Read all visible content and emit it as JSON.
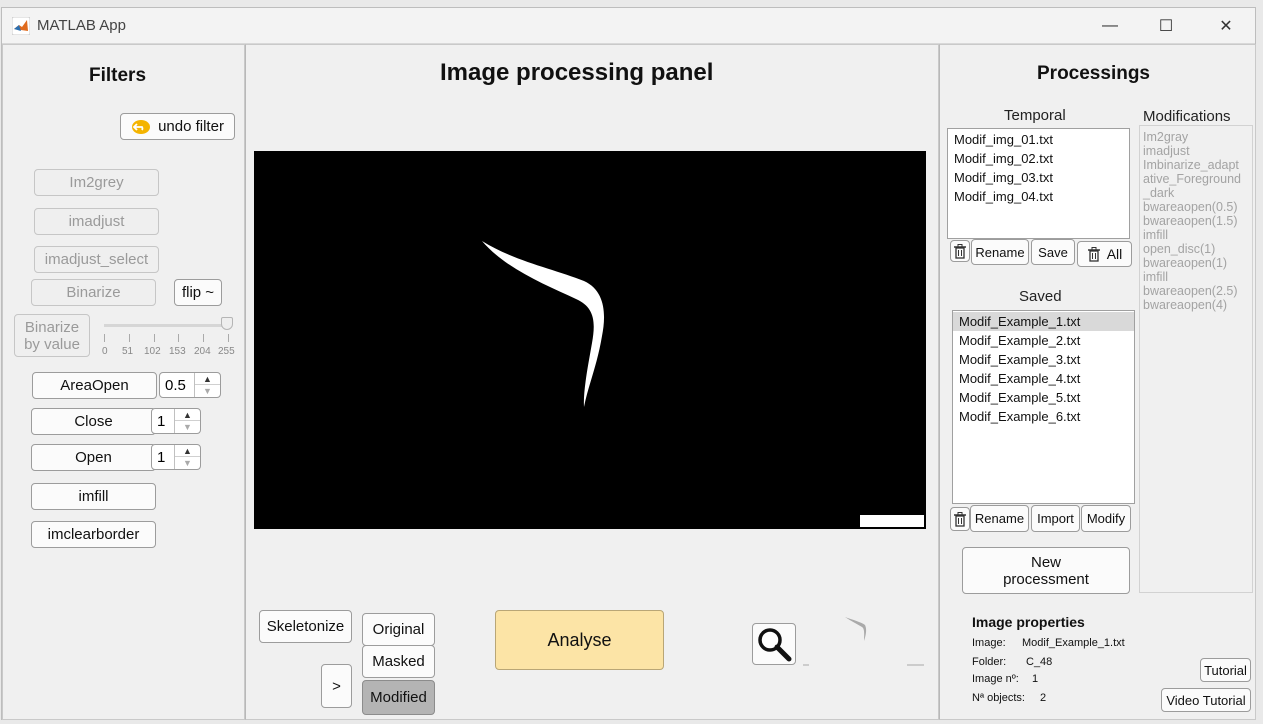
{
  "window": {
    "title": "MATLAB App",
    "controls": [
      "—",
      "☐",
      "✕"
    ]
  },
  "filters": {
    "heading": "Filters",
    "undo_label": "undo filter",
    "im2grey": "Im2grey",
    "imadjust": "imadjust",
    "imadjust_select": "imadjust_select",
    "binarize": "Binarize",
    "flip": "flip ~",
    "binarize_by_value_1": "Binarize",
    "binarize_by_value_2": "by value",
    "slider_value": 255,
    "slider_ticks": [
      "0",
      "51",
      "102",
      "153",
      "204",
      "255"
    ],
    "areaopen": "AreaOpen",
    "areaopen_value": "0.5",
    "close": "Close",
    "close_value": "1",
    "open": "Open",
    "open_value": "1",
    "imfill": "imfill",
    "imclearborder": "imclearborder"
  },
  "center": {
    "heading": "Image processing panel",
    "skeletonize": "Skeletonize",
    "arrow": ">",
    "original": "Original",
    "masked": "Masked",
    "modified": "Modified",
    "analyse": "Analyse"
  },
  "processings": {
    "heading": "Processings",
    "temporal_label": "Temporal",
    "temporal_items": [
      "Modif_img_01.txt",
      "Modif_img_02.txt",
      "Modif_img_03.txt",
      "Modif_img_04.txt"
    ],
    "rename": "Rename",
    "save": "Save",
    "all": "All",
    "saved_label": "Saved",
    "saved_items": [
      "Modif_Example_1.txt",
      "Modif_Example_2.txt",
      "Modif_Example_3.txt",
      "Modif_Example_4.txt",
      "Modif_Example_5.txt",
      "Modif_Example_6.txt"
    ],
    "rename2": "Rename",
    "import": "Import",
    "modify": "Modify",
    "new_processment_1": "New",
    "new_processment_2": "processment",
    "modifications_label": "Modifications",
    "modifications": [
      "Im2gray",
      "imadjust",
      "Imbinarize_adapt",
      "ative_Foreground",
      "_dark",
      "bwareaopen(0.5)",
      "bwareaopen(1.5)",
      "imfill",
      "open_disc(1)",
      "bwareaopen(1)",
      "imfill",
      "bwareaopen(2.5)",
      "bwareaopen(4)"
    ]
  },
  "properties": {
    "heading": "Image properties",
    "image_label": "Image:",
    "image_value": "Modif_Example_1.txt",
    "folder_label": "Folder:",
    "folder_value": "C_48",
    "num_label": "Image nº:",
    "num_value": "1",
    "objects_label": "Nª objects:",
    "objects_value": "2",
    "tutorial": "Tutorial",
    "video_tutorial": "Video Tutorial"
  },
  "colors": {
    "analyse_bg": "#fce4a6",
    "modified_bg": "#b4b4b4"
  },
  "icons": [
    "matlab-icon",
    "undo-icon",
    "trash-icon",
    "magnifier-icon"
  ]
}
